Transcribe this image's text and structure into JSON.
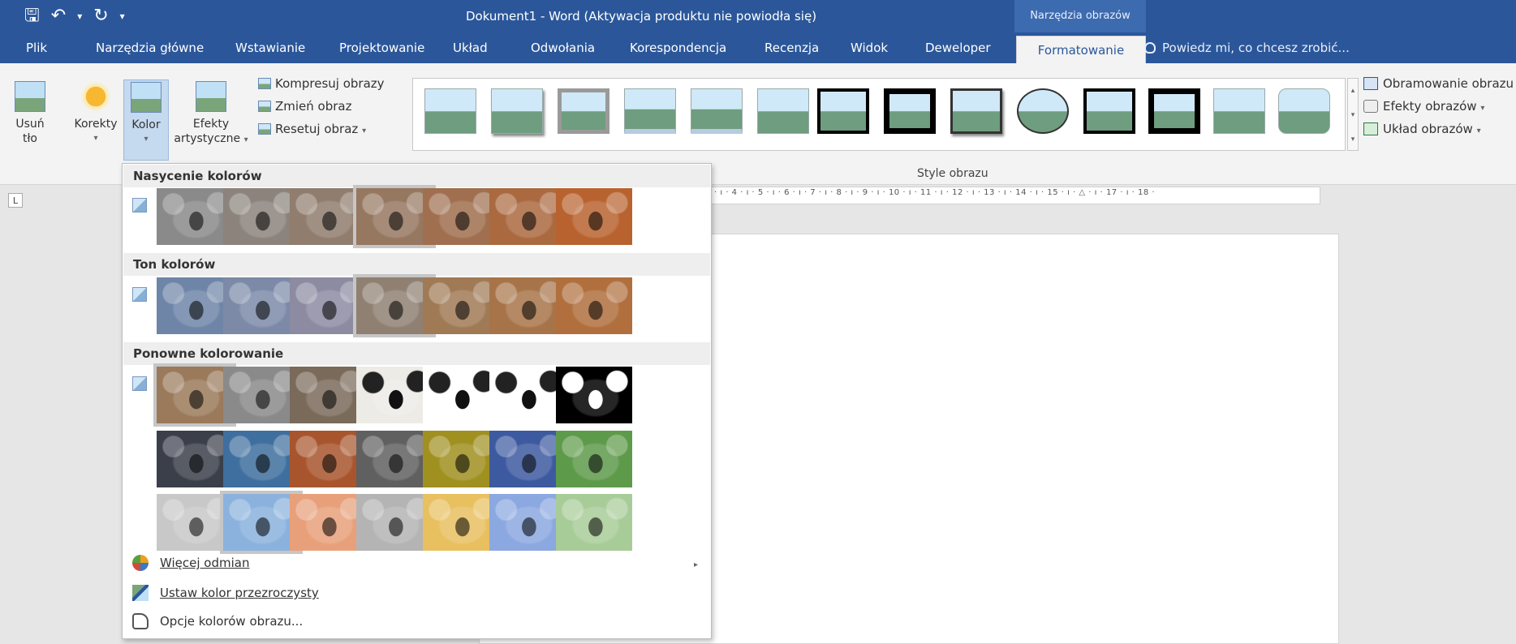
{
  "qat": {
    "save_icon": "save-icon",
    "undo_icon": "undo-icon",
    "redo_icon": "redo-icon",
    "customize_icon": "customize-qat-icon"
  },
  "window": {
    "title": "Dokument1 - Word (Aktywacja produktu nie powiodła się)",
    "context_tab_group": "Narzędzia obrazów"
  },
  "tabs": [
    {
      "label": "Plik"
    },
    {
      "label": "Narzędzia główne"
    },
    {
      "label": "Wstawianie"
    },
    {
      "label": "Projektowanie"
    },
    {
      "label": "Układ"
    },
    {
      "label": "Odwołania"
    },
    {
      "label": "Korespondencja"
    },
    {
      "label": "Recenzja"
    },
    {
      "label": "Widok"
    },
    {
      "label": "Deweloper"
    },
    {
      "label": "Formatowanie"
    }
  ],
  "tell_me": {
    "text": "Powiedz mi, co chcesz zrobić..."
  },
  "ribbon": {
    "remove_bg": {
      "line1": "Usuń",
      "line2": "tło"
    },
    "corrections": {
      "label": "Korekty"
    },
    "color": {
      "label": "Kolor"
    },
    "artistic": {
      "line1": "Efekty",
      "line2": "artystyczne"
    },
    "compress": "Kompresuj obrazy",
    "change": "Zmień obraz",
    "reset": "Resetuj obraz",
    "styles_group_label": "Style obrazu",
    "picture_border": "Obramowanie obrazu",
    "picture_effects": "Efekty obrazów",
    "picture_layout": "Układ obrazów"
  },
  "ruler": {
    "corner": "L",
    "text": "· ı · 4 · ı · 5 · ı · 6 · ı · 7 · ı · 8 · ı · 9 · ı · 10 · ı · 11 · ı · 12 · ı · 13 · ı · 14 · ı · 15 · ı · △ · ı · 17 · ı · 18 ·"
  },
  "dropdown": {
    "saturation_header": "Nasycenie kolorów",
    "tone_header": "Ton kolorów",
    "recolor_header": "Ponowne kolorowanie",
    "more_variations": "Więcej odmian",
    "set_transparent": "Ustaw kolor przezroczysty",
    "color_options": "Opcje kolorów obrazu..."
  },
  "colors": {
    "title_bar": "#2b579a",
    "ribbon_bg": "#f3f3f3",
    "selected_outline": "#c6c6c6",
    "saturation_row": [
      "#8a8a8a",
      "#8b837c",
      "#907d6e",
      "#967760",
      "#a06f4f",
      "#ab693f",
      "#b8632f"
    ],
    "tone_row": [
      "#6f85a8",
      "#7c8aa8",
      "#8c8ba2",
      "#8f8072",
      "#a07a55",
      "#a77449",
      "#b06f3d"
    ],
    "recolor_row1": [
      "#9a7a5a",
      "#8a8a8a",
      "#7a6a5a",
      "#ecebe6",
      "#ffffff",
      "#ffffff",
      "#000000"
    ],
    "recolor_row2": [
      "#3a3f4a",
      "#3e6f9e",
      "#a8552d",
      "#606060",
      "#a09020",
      "#3d5aa0",
      "#5d9a4a"
    ],
    "recolor_row3": [
      "#c8c8c8",
      "#8bb2dd",
      "#e8a07a",
      "#b4b4b4",
      "#e8c060",
      "#8ba8e0",
      "#a8cc98"
    ]
  }
}
